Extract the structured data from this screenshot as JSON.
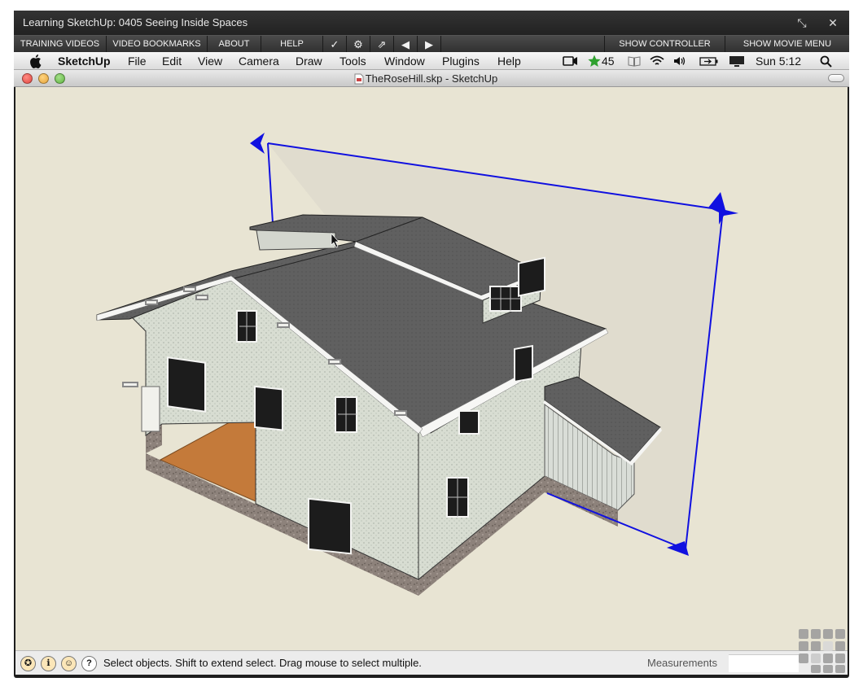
{
  "player": {
    "title": "Learning SketchUp: 0405 Seeing Inside Spaces",
    "shrink_icon": "shrink-arrows-icon",
    "close_icon": "close-x-icon",
    "toolbar": {
      "training_videos": "TRAINING VIDEOS",
      "video_bookmarks": "VIDEO BOOKMARKS",
      "about": "ABOUT",
      "help": "HELP",
      "checkmark_icon": "checkmark-icon",
      "gear_icon": "gear-icon",
      "popout_icon": "popout-icon",
      "prev_icon": "previous-triangle-icon",
      "next_icon": "next-triangle-icon",
      "show_controller": "SHOW CONTROLLER",
      "show_movie_menu": "SHOW MOVIE MENU"
    }
  },
  "menubar": {
    "apple_icon": "apple-logo-icon",
    "app_name": "SketchUp",
    "items": [
      "File",
      "Edit",
      "View",
      "Camera",
      "Draw",
      "Tools",
      "Window",
      "Plugins",
      "Help"
    ],
    "status": {
      "camera_icon": "camcorder-icon",
      "star_icon": "star-icon",
      "star_count": "45",
      "book_icon": "book-icon",
      "wifi_icon": "wifi-icon",
      "volume_icon": "volume-icon",
      "battery_icon": "battery-icon",
      "display_icon": "display-icon",
      "clock": "Sun 5:12",
      "search_icon": "spotlight-search-icon"
    }
  },
  "document": {
    "title": "TheRoseHill.skp - SketchUp",
    "file_icon": "document-icon",
    "traffic_lights": {
      "close": "#e2463f",
      "minimize": "#e5a43a",
      "zoom": "#5fb53f"
    }
  },
  "viewport": {
    "background": "#e8e4d3",
    "section_plane_color": "#1010e0",
    "roof_color": "#5e5e5e",
    "wall_color": "#d6dbd0",
    "foundation_color": "#8a7f78",
    "floor_color": "#c47a3a"
  },
  "statusbar": {
    "icons": [
      "geo-location-icon",
      "credits-icon",
      "user-icon",
      "help-question-icon"
    ],
    "message": "Select objects. Shift to extend select. Drag mouse to select multiple.",
    "measurements_label": "Measurements",
    "measurements_value": ""
  },
  "grip_icon": "resize-grip-icon"
}
